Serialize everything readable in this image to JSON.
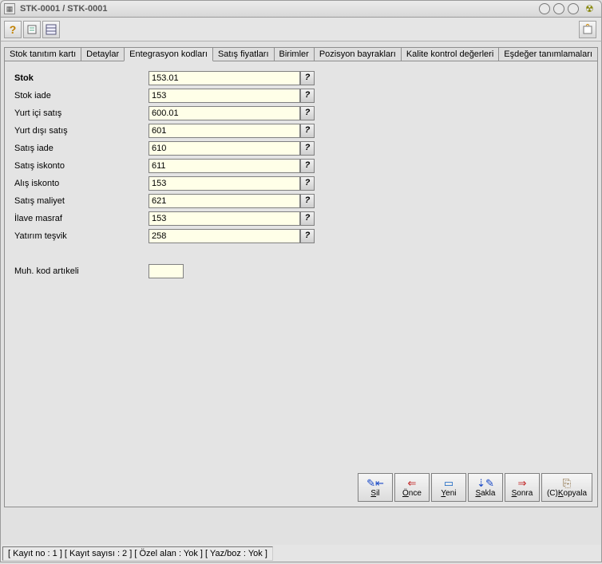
{
  "title": "STK-0001 / STK-0001",
  "toolbar": {
    "help": "?",
    "icon2": "form-icon",
    "icon3": "grid-icon",
    "right_icon": "export-icon"
  },
  "tabs": [
    {
      "label": "Stok tanıtım kartı"
    },
    {
      "label": "Detaylar"
    },
    {
      "label": "Entegrasyon kodları",
      "selected": true
    },
    {
      "label": "Satış fiyatları"
    },
    {
      "label": "Birimler"
    },
    {
      "label": "Pozisyon bayrakları"
    },
    {
      "label": "Kalite kontrol değerleri"
    },
    {
      "label": "Eşdeğer tanımlamaları"
    }
  ],
  "fields": [
    {
      "label": "Stok",
      "value": "153.01",
      "bold": true
    },
    {
      "label": "Stok iade",
      "value": "153"
    },
    {
      "label": "Yurt içi satış",
      "value": "600.01"
    },
    {
      "label": "Yurt dışı satış",
      "value": "601"
    },
    {
      "label": "Satış iade",
      "value": "610"
    },
    {
      "label": "Satış iskonto",
      "value": "611"
    },
    {
      "label": "Alış iskonto",
      "value": "153"
    },
    {
      "label": "Satış maliyet",
      "value": "621"
    },
    {
      "label": "İlave masraf",
      "value": "153"
    },
    {
      "label": "Yatırım teşvik",
      "value": "258"
    }
  ],
  "extra_field": {
    "label": "Muh. kod artıkeli",
    "value": ""
  },
  "help_glyph": "?",
  "actions": {
    "sil": {
      "u": "S",
      "rest": "il"
    },
    "once": {
      "u": "Ö",
      "rest": "nce"
    },
    "yeni": {
      "u": "Y",
      "rest": "eni"
    },
    "sakla": {
      "u": "S",
      "rest": "akla"
    },
    "sonra": {
      "u": "S",
      "rest": "onra"
    },
    "kopyala": {
      "prefix": "(C)",
      "u": "K",
      "rest": "opyala"
    }
  },
  "status": "[ Kayıt no : 1 ] [ Kayıt sayısı : 2 ] [ Özel alan : Yok ] [ Yaz/boz : Yok ]"
}
